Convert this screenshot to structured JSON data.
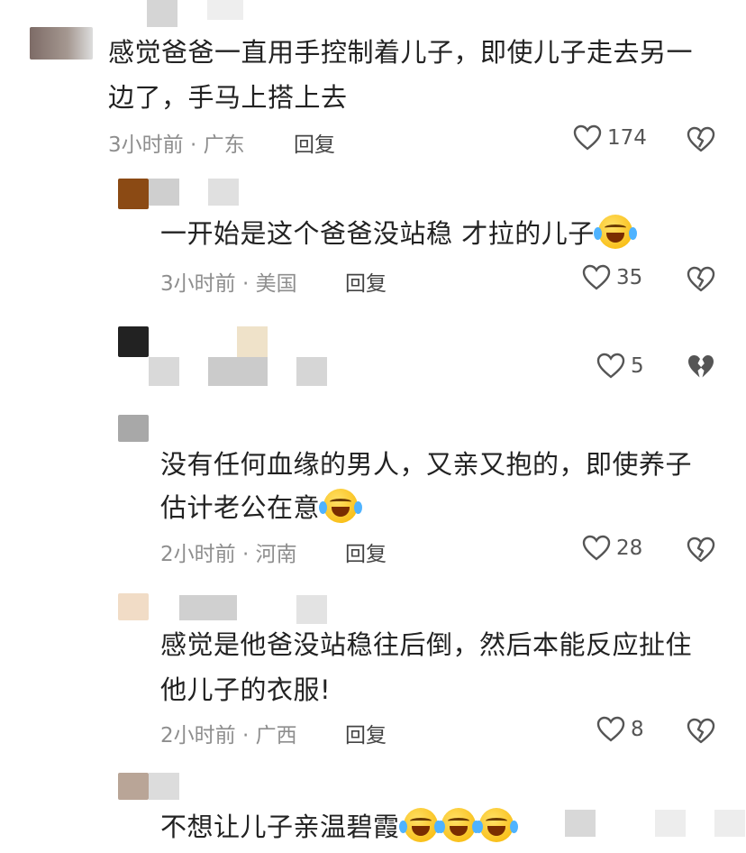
{
  "comments": [
    {
      "text_lines": [
        "感觉爸爸一直用手控制着儿子，即使儿子走去另一",
        "边了，手马上搭上去"
      ],
      "meta": "3小时前 · 广东",
      "reply": "回复",
      "likes": "174"
    },
    {
      "text_lines": [
        "一开始是这个爸爸没站稳 才拉的儿子"
      ],
      "meta": "3小时前 · 美国",
      "reply": "回复",
      "likes": "35"
    },
    {
      "likes": "5"
    },
    {
      "text_lines": [
        "没有任何血缘的男人，又亲又抱的，即使养子",
        "估计老公在意"
      ],
      "meta": "2小时前 · 河南",
      "reply": "回复",
      "likes": "28"
    },
    {
      "text_lines": [
        "感觉是他爸没站稳往后倒，然后本能反应扯住",
        "他儿子的衣服!"
      ],
      "meta": "2小时前 · 广西",
      "reply": "回复",
      "likes": "8"
    },
    {
      "text_lines": [
        "不想让儿子亲温碧霞"
      ]
    }
  ],
  "icons": {
    "like": "heart-outline-icon",
    "dislike": "broken-heart-outline-icon",
    "emoji": "rofl-emoji-icon"
  },
  "colors": {
    "text": "#222222",
    "meta": "#8e8e8e",
    "icon": "#555555"
  }
}
